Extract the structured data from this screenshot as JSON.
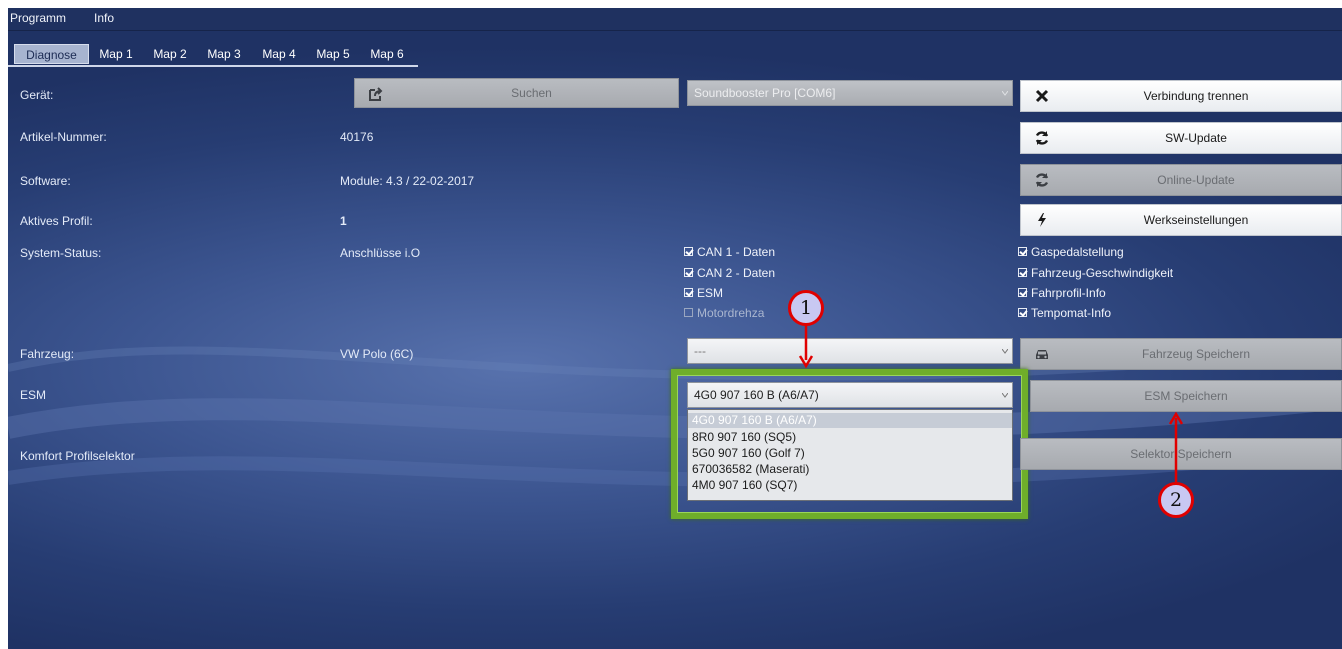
{
  "menu": {
    "items": [
      "Programm",
      "Info"
    ]
  },
  "tabs": [
    "Diagnose",
    "Map 1",
    "Map 2",
    "Map 3",
    "Map 4",
    "Map 5",
    "Map 6"
  ],
  "fields": {
    "device_label": "Gerät:",
    "article_label": "Artikel-Nummer:",
    "article_value": "40176",
    "software_label": "Software:",
    "software_value": "Module: 4.3 / 22-02-2017",
    "profile_label": "Aktives Profil:",
    "profile_value": "1",
    "status_label": "System-Status:",
    "status_value": "Anschlüsse i.O",
    "vehicle_label": "Fahrzeug:",
    "vehicle_value": "VW Polo (6C)",
    "esm_label": "ESM",
    "comfort_label": "Komfort Profilselektor"
  },
  "search_button": {
    "label": "Suchen",
    "icon": "share-icon"
  },
  "device_select": {
    "value": "Soundbooster Pro [COM6]"
  },
  "vehicle_select": {
    "value": "---"
  },
  "esm_select": {
    "value": "4G0 907 160 B (A6/A7)",
    "options": [
      "4G0 907 160 B (A6/A7)",
      "8R0 907 160 (SQ5)",
      "5G0 907 160 (Golf 7)",
      "670036582 (Maserati)",
      "4M0 907 160 (SQ7)"
    ],
    "selected_index": 0
  },
  "right_buttons": {
    "disconnect": {
      "label": "Verbindung trennen",
      "icon": "close-x-icon"
    },
    "sw_update": {
      "label": "SW-Update",
      "icon": "refresh-icon"
    },
    "online_update": {
      "label": "Online-Update",
      "icon": "refresh-icon"
    },
    "factory": {
      "label": "Werkseinstellungen",
      "icon": "bolt-icon"
    },
    "vehicle_save": {
      "label": "Fahrzeug Speichern",
      "icon": "car-icon"
    },
    "esm_save": {
      "label": "ESM Speichern"
    },
    "selector_save": {
      "label": "Selektor Speichern"
    }
  },
  "checks_mid": [
    {
      "label": "CAN 1 - Daten",
      "checked": true
    },
    {
      "label": "CAN 2 - Daten",
      "checked": true
    },
    {
      "label": "ESM",
      "checked": true
    },
    {
      "label": "Motordrehza",
      "checked": false
    }
  ],
  "checks_right": [
    {
      "label": "Gaspedalstellung",
      "checked": true
    },
    {
      "label": "Fahrzeug-Geschwindigkeit",
      "checked": true
    },
    {
      "label": "Fahrprofil-Info",
      "checked": true
    },
    {
      "label": "Tempomat-Info",
      "checked": true
    }
  ],
  "callouts": {
    "one": "1",
    "two": "2"
  },
  "colors": {
    "highlight_frame": "#6fae2a",
    "callout_border": "#e00000",
    "callout_fill": "#c8c8f2"
  }
}
